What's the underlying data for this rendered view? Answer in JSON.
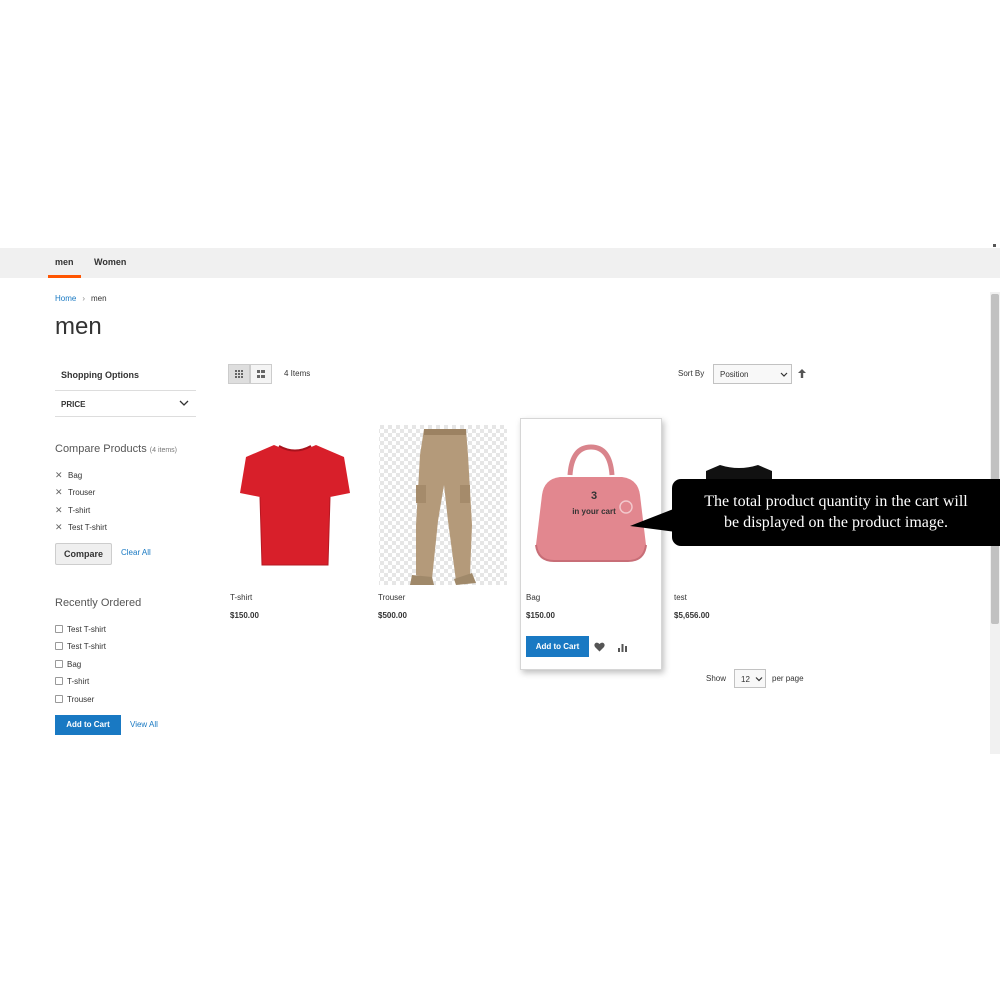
{
  "nav": {
    "items": [
      {
        "label": "men"
      },
      {
        "label": "Women"
      }
    ],
    "active_color": "#ff5501"
  },
  "breadcrumb": {
    "home": "Home",
    "current": "men"
  },
  "page_title": "men",
  "sidebar": {
    "shopping_options": "Shopping Options",
    "price_filter": "PRICE",
    "compare": {
      "title": "Compare Products",
      "count": "(4 items)",
      "items": [
        "Bag",
        "Trouser",
        "T-shirt",
        "Test T-shirt"
      ],
      "compare_button": "Compare",
      "clear_all": "Clear All"
    },
    "recently_ordered": {
      "title": "Recently Ordered",
      "items": [
        "Test T-shirt",
        "Test T-shirt",
        "Bag",
        "T-shirt",
        "Trouser"
      ],
      "add_to_cart": "Add to Cart",
      "view_all": "View All"
    }
  },
  "toolbar": {
    "item_count": "4 Items",
    "sort_label": "Sort By",
    "sort_value": "Position",
    "show_label": "Show",
    "limit_value": "12",
    "per_page": "per page"
  },
  "products": [
    {
      "name": "T-shirt",
      "price": "$150.00",
      "image": "red-tshirt"
    },
    {
      "name": "Trouser",
      "price": "$500.00",
      "image": "khaki-trouser"
    },
    {
      "name": "Bag",
      "price": "$150.00",
      "image": "pink-bag"
    },
    {
      "name": "test",
      "price": "$5,656.00",
      "image": "black-tshirt"
    }
  ],
  "hover_product": {
    "add_to_cart": "Add to Cart",
    "cart_qty": "3",
    "cart_text": "in your cart"
  },
  "callout": {
    "line1": "The total product quantity in the cart will",
    "line2": "be displayed on the product image."
  },
  "colors": {
    "primary": "#1979c3",
    "accent": "#ff5501",
    "callout_bg": "#000000"
  }
}
